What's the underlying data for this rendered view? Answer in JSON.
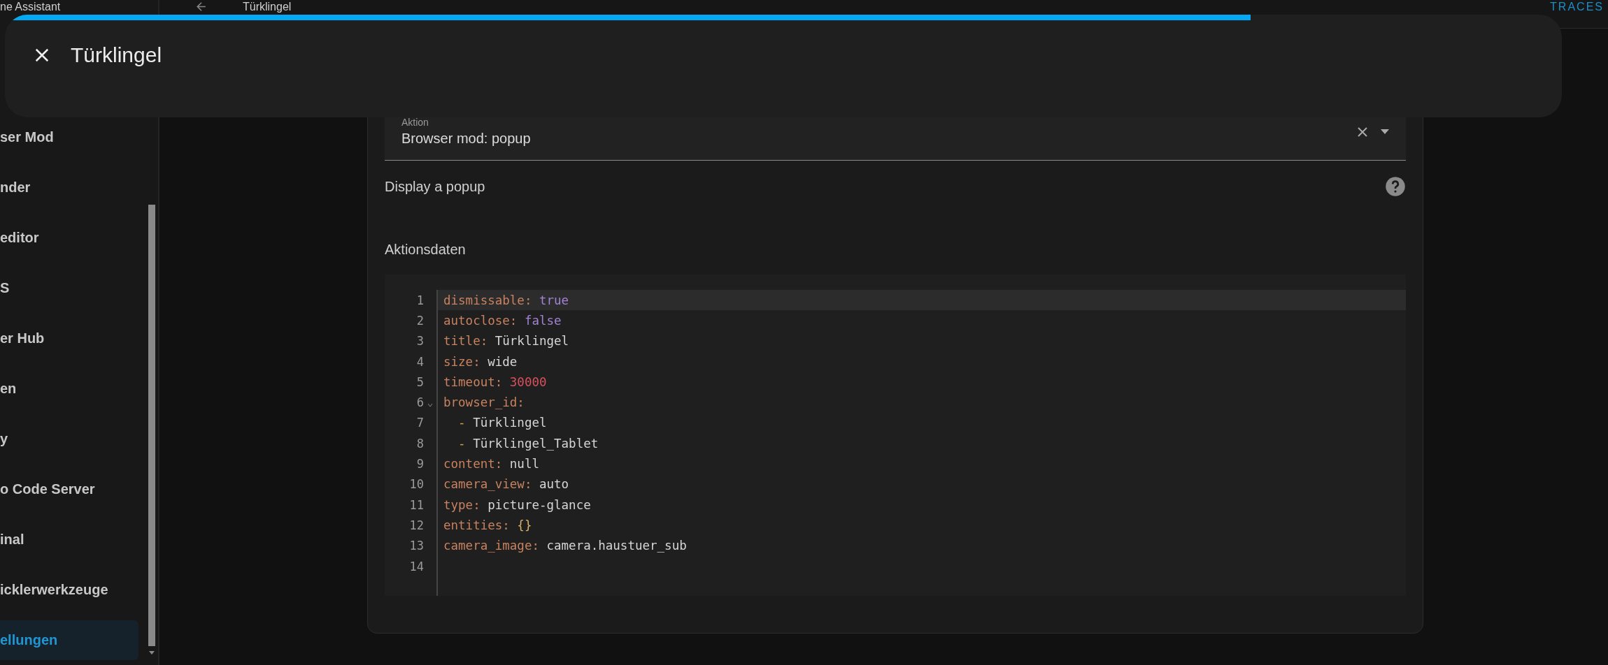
{
  "sidebar": {
    "title": "ne Assistant",
    "items": [
      {
        "label": "ser Mod",
        "selected": false
      },
      {
        "label": "nder",
        "selected": false
      },
      {
        "label": "editor",
        "selected": false
      },
      {
        "label": "S",
        "selected": false
      },
      {
        "label": "er Hub",
        "selected": false
      },
      {
        "label": "en",
        "selected": false
      },
      {
        "label": "y",
        "selected": false
      },
      {
        "label": "o Code Server",
        "selected": false
      },
      {
        "label": "inal",
        "selected": false
      },
      {
        "label": "icklerwerkzeuge",
        "selected": false
      },
      {
        "label": "ellungen",
        "selected": true
      }
    ]
  },
  "header": {
    "title": "Türklingel",
    "action": "TRACES"
  },
  "popup": {
    "title": "Türklingel",
    "level": 0.8
  },
  "action": {
    "label": "Aktion",
    "value": "Browser mod: popup",
    "description": "Display a popup"
  },
  "action_data": {
    "label": "Aktionsdaten",
    "lines": [
      {
        "number": "1",
        "active": true,
        "foldable": false,
        "tokens": [
          {
            "text": "dismissable: ",
            "kind": "key"
          },
          {
            "text": "true",
            "kind": "bool"
          }
        ]
      },
      {
        "number": "2",
        "active": false,
        "foldable": false,
        "tokens": [
          {
            "text": "autoclose: ",
            "kind": "key"
          },
          {
            "text": "false",
            "kind": "bool"
          }
        ]
      },
      {
        "number": "3",
        "active": false,
        "foldable": false,
        "tokens": [
          {
            "text": "title: ",
            "kind": "key"
          },
          {
            "text": "Türklingel",
            "kind": "str"
          }
        ]
      },
      {
        "number": "4",
        "active": false,
        "foldable": false,
        "tokens": [
          {
            "text": "size: ",
            "kind": "key"
          },
          {
            "text": "wide",
            "kind": "str"
          }
        ]
      },
      {
        "number": "5",
        "active": false,
        "foldable": false,
        "tokens": [
          {
            "text": "timeout: ",
            "kind": "key"
          },
          {
            "text": "30000",
            "kind": "num"
          }
        ]
      },
      {
        "number": "6",
        "active": false,
        "foldable": true,
        "tokens": [
          {
            "text": "browser_id:",
            "kind": "key"
          }
        ]
      },
      {
        "number": "7",
        "active": false,
        "foldable": false,
        "tokens": [
          {
            "text": "  - ",
            "kind": "dash"
          },
          {
            "text": "Türklingel",
            "kind": "str"
          }
        ]
      },
      {
        "number": "8",
        "active": false,
        "foldable": false,
        "tokens": [
          {
            "text": "  - ",
            "kind": "dash"
          },
          {
            "text": "Türklingel_Tablet",
            "kind": "str"
          }
        ]
      },
      {
        "number": "9",
        "active": false,
        "foldable": false,
        "tokens": [
          {
            "text": "content: ",
            "kind": "key"
          },
          {
            "text": "null",
            "kind": "str"
          }
        ]
      },
      {
        "number": "10",
        "active": false,
        "foldable": false,
        "tokens": [
          {
            "text": "camera_view: ",
            "kind": "key"
          },
          {
            "text": "auto",
            "kind": "str"
          }
        ]
      },
      {
        "number": "11",
        "active": false,
        "foldable": false,
        "tokens": [
          {
            "text": "type: ",
            "kind": "key"
          },
          {
            "text": "picture-glance",
            "kind": "str"
          }
        ]
      },
      {
        "number": "12",
        "active": false,
        "foldable": false,
        "tokens": [
          {
            "text": "entities: ",
            "kind": "key"
          },
          {
            "text": "{}",
            "kind": "brace"
          }
        ]
      },
      {
        "number": "13",
        "active": false,
        "foldable": false,
        "tokens": [
          {
            "text": "camera_image: ",
            "kind": "key"
          },
          {
            "text": "camera.haustuer_sub",
            "kind": "str"
          }
        ]
      },
      {
        "number": "14",
        "active": false,
        "foldable": false
      }
    ]
  }
}
